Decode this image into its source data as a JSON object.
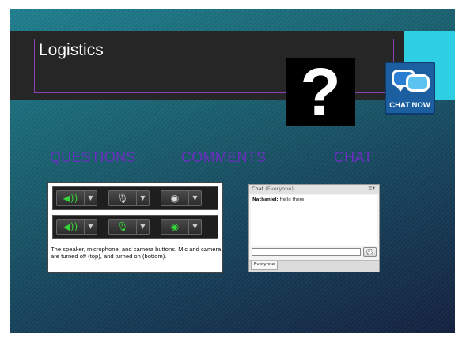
{
  "slide": {
    "title": "Logistics",
    "question_mark": "?",
    "chat_now_label": "CHAT NOW",
    "headings": [
      "QUESTIONS",
      "COMMENTS",
      "CHAT"
    ]
  },
  "av_panel": {
    "caption": "The speaker, microphone, and camera buttons. Mic and camera are turned off (top), and turned on (bottom).",
    "rows": [
      {
        "speaker": "on",
        "mic": "off",
        "camera": "off"
      },
      {
        "speaker": "on",
        "mic": "on",
        "camera": "on"
      }
    ],
    "icons": {
      "speaker": "speaker-icon",
      "mic": "microphone-icon",
      "camera": "camera-icon",
      "dropdown": "chevron-down-icon"
    }
  },
  "chat_panel": {
    "title": "Chat",
    "scope": "(Everyone)",
    "menu": "≡▾",
    "message_sender": "Nathaniel:",
    "message_text": "Hello there!",
    "input_value": "",
    "tab_label": "Everyone"
  },
  "colors": {
    "accent_cyan": "#2ecfe2",
    "heading_purple": "#6a2fbf",
    "title_bar": "#262626",
    "title_border": "#8b3fb2",
    "device_on": "#35d438"
  }
}
